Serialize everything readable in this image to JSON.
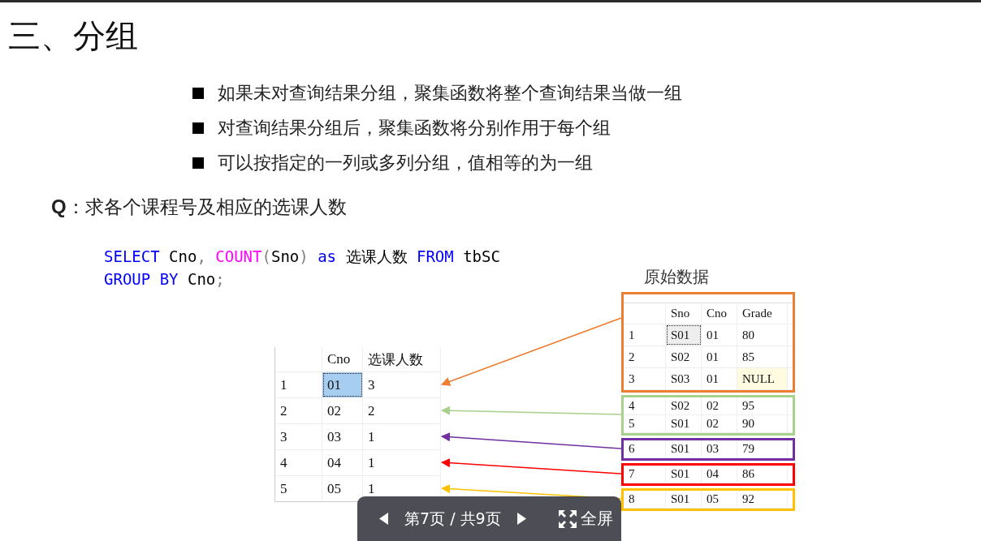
{
  "slide": {
    "title": "三、分组",
    "bullets": [
      "如果未对查询结果分组，聚集函数将整个查询结果当做一组",
      "对查询结果分组后，聚集函数将分别作用于每个组",
      "可以按指定的一列或多列分组，值相等的为一组"
    ],
    "question": {
      "label": "Q",
      "text": "：求各个课程号及相应的选课人数"
    },
    "code": [
      [
        {
          "kind": "keyword",
          "text": "SELECT"
        },
        {
          "kind": "plain",
          "text": " Cno"
        },
        {
          "kind": "punct",
          "text": ", "
        },
        {
          "kind": "function",
          "text": "COUNT"
        },
        {
          "kind": "punct",
          "text": "("
        },
        {
          "kind": "plain",
          "text": "Sno"
        },
        {
          "kind": "punct",
          "text": ") "
        },
        {
          "kind": "keyword",
          "text": "as"
        },
        {
          "kind": "plain",
          "text": " 选课人数 "
        },
        {
          "kind": "keyword",
          "text": "FROM"
        },
        {
          "kind": "plain",
          "text": " tbSC"
        }
      ],
      [
        {
          "kind": "keyword",
          "text": "GROUP BY"
        },
        {
          "kind": "plain",
          "text": " Cno"
        },
        {
          "kind": "punct",
          "text": ";"
        }
      ]
    ],
    "result_table": {
      "columns": [
        "",
        "Cno",
        "选课人数"
      ],
      "rows": [
        {
          "cells": [
            "1",
            "01",
            "3"
          ],
          "selected": true
        },
        {
          "cells": [
            "2",
            "02",
            "2"
          ],
          "selected": false
        },
        {
          "cells": [
            "3",
            "03",
            "1"
          ],
          "selected": false
        },
        {
          "cells": [
            "4",
            "04",
            "1"
          ],
          "selected": false
        },
        {
          "cells": [
            "5",
            "05",
            "1"
          ],
          "selected": false
        }
      ]
    },
    "source_label": "原始数据",
    "source_table": {
      "columns": [
        "",
        "Sno",
        "Cno",
        "Grade"
      ],
      "groups": [
        {
          "color": "#ed7d31",
          "rows": [
            {
              "cells": [
                "1",
                "S01",
                "01",
                "80"
              ],
              "selected": true,
              "null_grade": false
            },
            {
              "cells": [
                "2",
                "S02",
                "01",
                "85"
              ],
              "selected": false,
              "null_grade": false
            },
            {
              "cells": [
                "3",
                "S03",
                "01",
                "NULL"
              ],
              "selected": false,
              "null_grade": true
            }
          ]
        },
        {
          "color": "#a9d18e",
          "rows": [
            {
              "cells": [
                "4",
                "S02",
                "02",
                "95"
              ],
              "selected": false,
              "null_grade": false
            },
            {
              "cells": [
                "5",
                "S01",
                "02",
                "90"
              ],
              "selected": false,
              "null_grade": false
            }
          ]
        },
        {
          "color": "#7030a0",
          "rows": [
            {
              "cells": [
                "6",
                "S01",
                "03",
                "79"
              ],
              "selected": false,
              "null_grade": false
            }
          ]
        },
        {
          "color": "#ff0000",
          "rows": [
            {
              "cells": [
                "7",
                "S01",
                "04",
                "86"
              ],
              "selected": false,
              "null_grade": false
            }
          ]
        },
        {
          "color": "#ffc000",
          "rows": [
            {
              "cells": [
                "8",
                "S01",
                "05",
                "92"
              ],
              "selected": false,
              "null_grade": false
            }
          ]
        }
      ]
    }
  },
  "viewer": {
    "page": "第7页 / 共9页",
    "fullscreen": "全屏"
  }
}
